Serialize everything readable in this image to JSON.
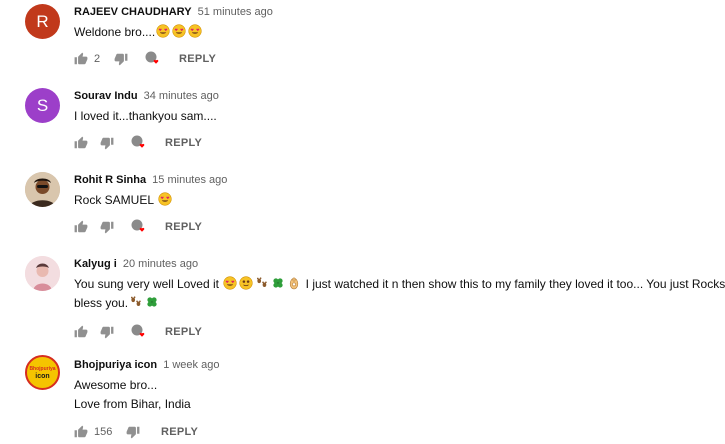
{
  "comments": [
    {
      "author": "RAJEEV CHAUDHARY",
      "time": "51 minutes ago",
      "text": "Weldone bro....",
      "emoji_after": [
        "heart-eyes",
        "heart-eyes",
        "heart-eyes"
      ],
      "likes": "2",
      "reply": "REPLY",
      "avatar_letter": "R",
      "avatar_color": "#c1391b",
      "creator_heart": true
    },
    {
      "author": "Sourav Indu",
      "time": "34 minutes ago",
      "text": "I loved it...thankyou sam....",
      "likes": "",
      "reply": "REPLY",
      "avatar_letter": "S",
      "avatar_color": "#9c3fc9",
      "creator_heart": true
    },
    {
      "author": "Rohit R Sinha",
      "time": "15 minutes ago",
      "text": "Rock SAMUEL",
      "emoji_after": [
        "heart-eyes"
      ],
      "likes": "",
      "reply": "REPLY",
      "creator_heart": true
    },
    {
      "author": "Kalyug i",
      "time": "20 minutes ago",
      "text_line1_a": "You sung very well Loved it",
      "text_line1_b": "I just watched it n then show this to my family they loved it too... You just Rocks",
      "text_line2": "bless you.",
      "likes": "",
      "reply": "REPLY",
      "creator_heart": true
    },
    {
      "author": "Bhojpuriya icon",
      "time": "1 week ago",
      "text_line1": "Awesome bro...",
      "text_line2": "Love from Bihar, India",
      "likes": "156",
      "reply": "REPLY",
      "avatar_logo_top": "Bhojpuriya",
      "avatar_logo_bottom": "icon",
      "creator_heart": false
    }
  ],
  "icons": {
    "like": "thumbs-up-icon",
    "dislike": "thumbs-down-icon",
    "heart": "creator-heart-icon",
    "emoji_heart_eyes": "heart-eyes-emoji",
    "emoji_star_struck": "star-struck-emoji",
    "emoji_paw": "paw-prints-emoji",
    "emoji_clover": "four-leaf-clover-emoji",
    "emoji_ok": "ok-hand-emoji"
  },
  "colors": {
    "text": "#0f0f0f",
    "secondary": "#606060",
    "heart": "#ff0000"
  }
}
